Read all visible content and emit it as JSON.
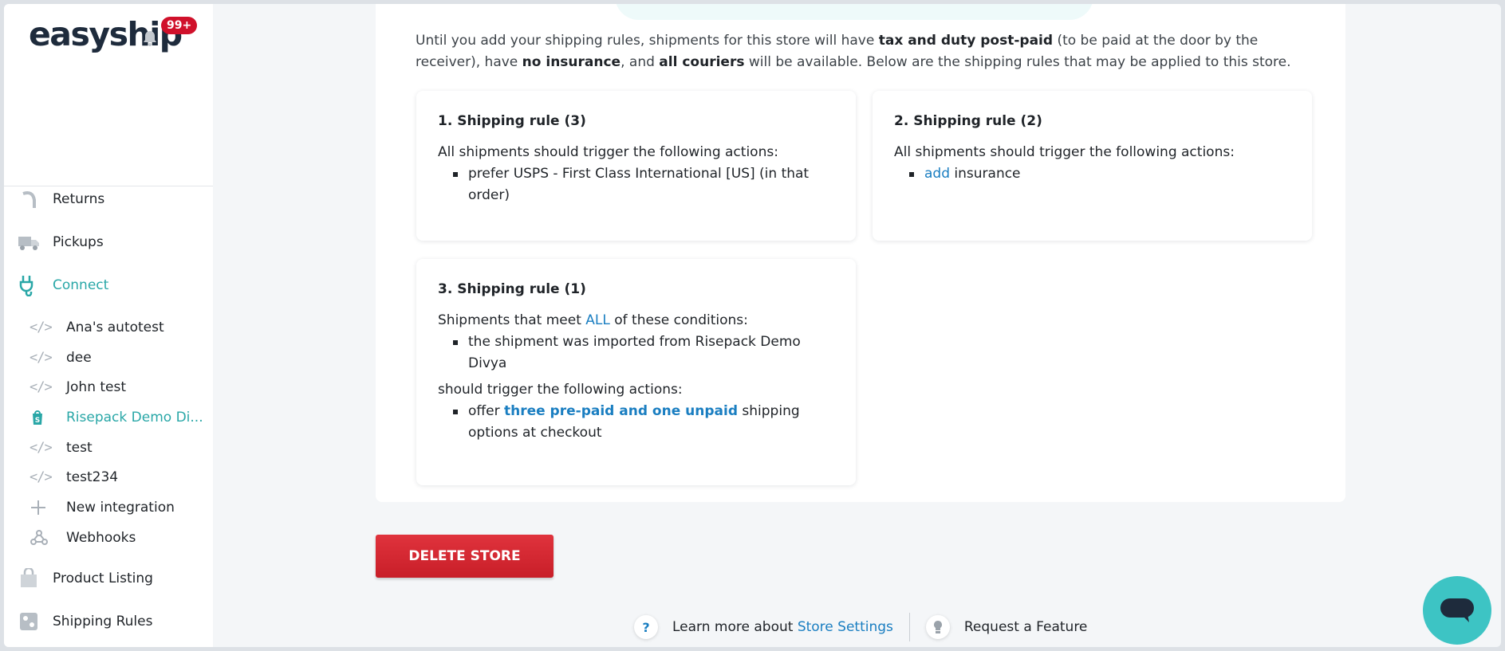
{
  "sidebar": {
    "logo": "easyship",
    "notification_count": "99+",
    "nav": {
      "returns": "Returns",
      "pickups": "Pickups",
      "connect": "Connect",
      "product_listing": "Product Listing",
      "shipping_rules": "Shipping Rules"
    },
    "integrations": [
      {
        "label": "Ana's autotest",
        "icon": "code-icon"
      },
      {
        "label": "dee",
        "icon": "code-icon"
      },
      {
        "label": "John test",
        "icon": "code-icon"
      },
      {
        "label": "Risepack Demo Di...",
        "icon": "shopify-icon",
        "active": true
      },
      {
        "label": "test",
        "icon": "code-icon"
      },
      {
        "label": "test234",
        "icon": "code-icon"
      }
    ],
    "new_integration": "New integration",
    "webhooks": "Webhooks"
  },
  "main": {
    "intro": {
      "p1": "Until you add your shipping rules, shipments for this store will have ",
      "b1": "tax and duty post-paid",
      "p2": " (to be paid at the door by the receiver), have ",
      "b2": "no insurance",
      "p3": ", and ",
      "b3": "all couriers",
      "p4": " will be available. Below are the shipping rules that may be applied to this store."
    },
    "rules": [
      {
        "title": "1. Shipping rule (3)",
        "trigger": "All shipments should trigger the following actions:",
        "action": "prefer USPS - First Class International [US] (in that order)"
      },
      {
        "title": "2. Shipping rule (2)",
        "trigger": "All shipments should trigger the following actions:",
        "action_link": "add",
        "action_rest": " insurance"
      },
      {
        "title": "3. Shipping rule (1)",
        "cond_prefix": "Shipments that meet ",
        "cond_link": "ALL",
        "cond_suffix": " of these conditions:",
        "condition": "the shipment was imported from Risepack Demo Divya",
        "trigger": "should trigger the following actions:",
        "action_prefix": "offer ",
        "action_link": "three pre-paid and one unpaid",
        "action_suffix": " shipping options at checkout"
      }
    ],
    "delete_button": "DELETE STORE"
  },
  "footer": {
    "help_glyph": "?",
    "learn_prefix": "Learn more about ",
    "learn_link": "Store Settings",
    "request_feature": "Request a Feature"
  },
  "colors": {
    "accent": "#29a7a7",
    "link": "#1a7ec1",
    "danger": "#d0112b",
    "chat": "#3dc4c4"
  }
}
